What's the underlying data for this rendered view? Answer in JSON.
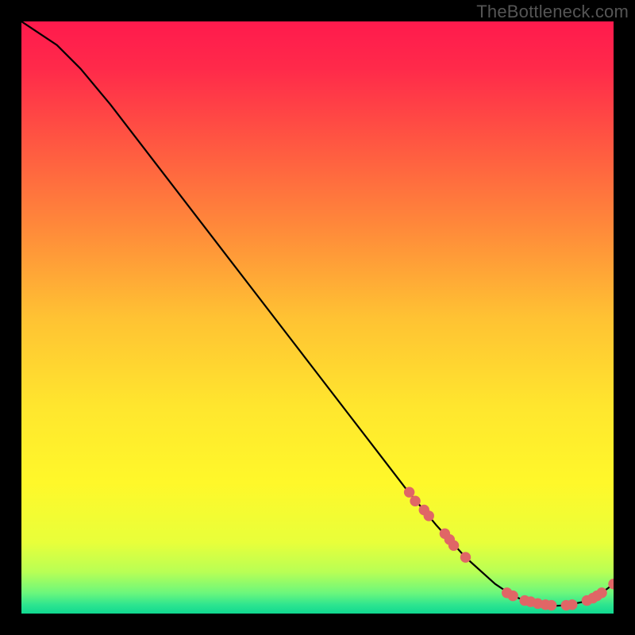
{
  "watermark": "TheBottleneck.com",
  "chart_data": {
    "type": "line",
    "title": "",
    "xlabel": "",
    "ylabel": "",
    "xlim": [
      0,
      100
    ],
    "ylim": [
      0,
      100
    ],
    "grid": false,
    "legend": false,
    "series": [
      {
        "name": "curve",
        "x": [
          0,
          3,
          6,
          10,
          15,
          20,
          25,
          30,
          35,
          40,
          45,
          50,
          55,
          60,
          65,
          70,
          75,
          80,
          83,
          85,
          88,
          90,
          92,
          95,
          98,
          100
        ],
        "y": [
          100,
          98,
          96,
          92,
          86,
          79.5,
          73,
          66.5,
          60,
          53.5,
          47,
          40.5,
          34,
          27.5,
          21,
          15,
          9.5,
          5,
          3,
          2.2,
          1.5,
          1.3,
          1.4,
          2,
          3.5,
          5
        ]
      }
    ],
    "dots": {
      "name": "markers",
      "color": "#e06666",
      "radius_pct": 0.9,
      "points": [
        {
          "x": 65.5,
          "y": 20.5
        },
        {
          "x": 66.5,
          "y": 19.0
        },
        {
          "x": 68.0,
          "y": 17.5
        },
        {
          "x": 68.8,
          "y": 16.5
        },
        {
          "x": 71.5,
          "y": 13.5
        },
        {
          "x": 72.3,
          "y": 12.5
        },
        {
          "x": 73.0,
          "y": 11.5
        },
        {
          "x": 75.0,
          "y": 9.5
        },
        {
          "x": 82.0,
          "y": 3.5
        },
        {
          "x": 83.0,
          "y": 3.0
        },
        {
          "x": 85.0,
          "y": 2.2
        },
        {
          "x": 86.0,
          "y": 2.0
        },
        {
          "x": 87.2,
          "y": 1.7
        },
        {
          "x": 88.5,
          "y": 1.5
        },
        {
          "x": 89.5,
          "y": 1.4
        },
        {
          "x": 92.0,
          "y": 1.4
        },
        {
          "x": 93.0,
          "y": 1.5
        },
        {
          "x": 95.5,
          "y": 2.2
        },
        {
          "x": 96.5,
          "y": 2.6
        },
        {
          "x": 97.2,
          "y": 3.0
        },
        {
          "x": 98.0,
          "y": 3.5
        },
        {
          "x": 100.0,
          "y": 5.0
        }
      ]
    },
    "gradient_stops": [
      {
        "offset": 0.0,
        "color": "#ff1a4d"
      },
      {
        "offset": 0.08,
        "color": "#ff2a4a"
      },
      {
        "offset": 0.2,
        "color": "#ff5542"
      },
      {
        "offset": 0.35,
        "color": "#ff8a3a"
      },
      {
        "offset": 0.5,
        "color": "#ffc233"
      },
      {
        "offset": 0.65,
        "color": "#ffe62e"
      },
      {
        "offset": 0.78,
        "color": "#fff82a"
      },
      {
        "offset": 0.88,
        "color": "#e8ff3a"
      },
      {
        "offset": 0.93,
        "color": "#b8ff55"
      },
      {
        "offset": 0.965,
        "color": "#6cf77c"
      },
      {
        "offset": 0.985,
        "color": "#2ee58f"
      },
      {
        "offset": 1.0,
        "color": "#10d890"
      }
    ]
  }
}
